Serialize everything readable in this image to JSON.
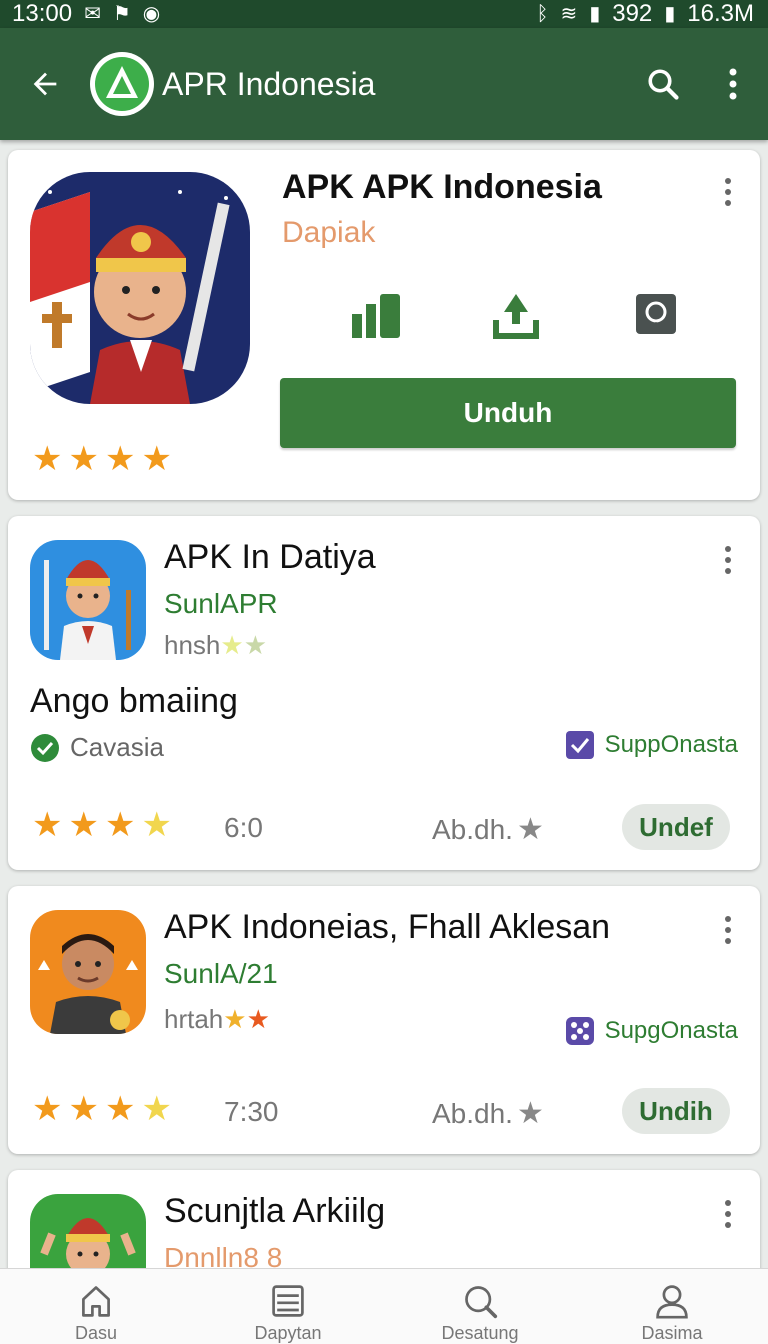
{
  "status_bar": {
    "time": "13:00",
    "battery": "392",
    "data": "16.3M"
  },
  "app_bar": {
    "title": "APR Indonesia",
    "back_icon": "back-arrow-icon",
    "search_icon": "search-icon",
    "menu_icon": "more-vert-icon"
  },
  "featured": {
    "title": "APK APK Indonesia",
    "developer": "Dapiak",
    "rating_stars": 4,
    "action_icons": [
      "chart-icon",
      "download-tray-icon",
      "screenshot-icon"
    ],
    "install_label": "Unduh"
  },
  "apps": [
    {
      "title": "APK In Datiya",
      "developer": "SunlAPR",
      "meta": "hnsh",
      "subtitle": "Ango bmaiing",
      "verified_label": "Cavasia",
      "badge_label": "SuppOnasta",
      "rating": 3.5,
      "count": "6:0",
      "count_prefix": "6",
      "count_text": ":0",
      "size": "Ab.dh.",
      "button_label": "Undef"
    },
    {
      "title": "APK Indoneias, Fhall Aklesan",
      "developer": "SunlA/21",
      "meta": "hrtah",
      "badge_label": "SupgOnasta",
      "rating": 3.5,
      "count": "7:30",
      "size": "Ab.dh.",
      "button_label": "Undih"
    },
    {
      "title": "Scunjtla Arkiilg",
      "developer": "Dnnlln8 8"
    }
  ],
  "bottom_nav": [
    {
      "label": "Dasu",
      "icon": "home-icon"
    },
    {
      "label": "Dapytan",
      "icon": "list-icon"
    },
    {
      "label": "Desatung",
      "icon": "search-icon"
    },
    {
      "label": "Dasima",
      "icon": "profile-icon"
    }
  ],
  "colors": {
    "status_bar": "#1f4a2c",
    "app_bar": "#2f5e3b",
    "primary_button": "#3a7d3c",
    "developer_green": "#2e7d32",
    "developer_orange": "#e49a6c",
    "star": "#f29a1c"
  }
}
